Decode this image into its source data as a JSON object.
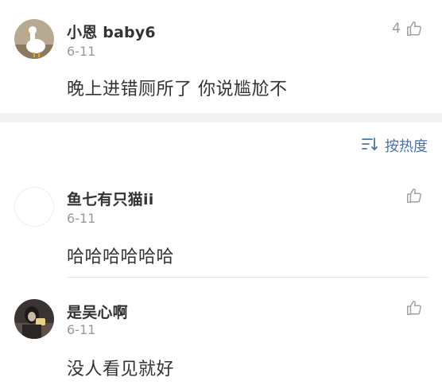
{
  "top_comment": {
    "username": "小恩 baby6",
    "date": "6-11",
    "text": "晚上进错厕所了 你说尴尬不",
    "likes": "4",
    "avatar_icon": "white-goose-avatar"
  },
  "sort": {
    "label": "按热度",
    "icon": "sort-icon",
    "color": "#4a73a8"
  },
  "comments": [
    {
      "username": "鱼七有只猫ii",
      "date": "6-11",
      "text": "哈哈哈哈哈哈",
      "avatar_icon": "blank-avatar",
      "like_icon": "thumbs-up-icon"
    },
    {
      "username": "是吴心啊",
      "date": "6-11",
      "text": "没人看见就好",
      "avatar_icon": "dark-photo-avatar",
      "like_icon": "thumbs-up-icon"
    }
  ]
}
